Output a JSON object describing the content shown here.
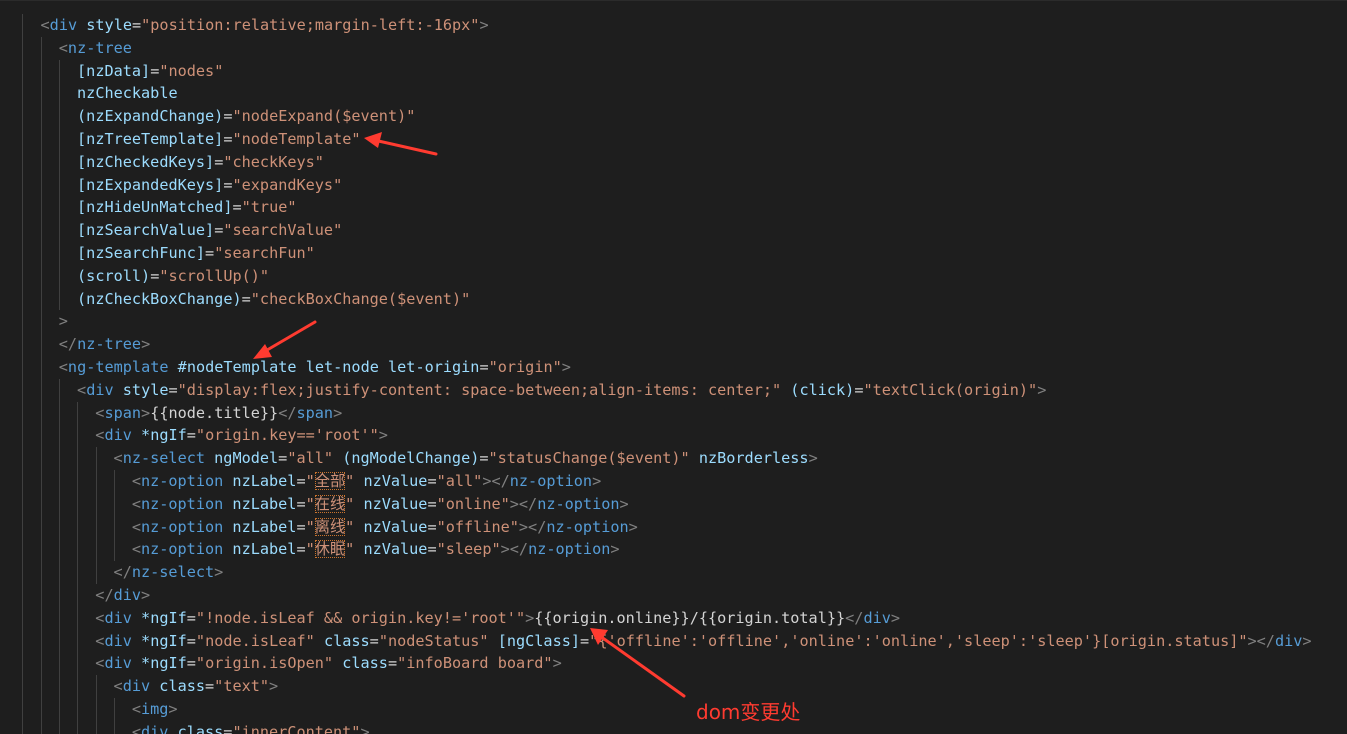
{
  "editor": {
    "theme_colors": {
      "background": "#1e1e1e",
      "tag": "#569cd6",
      "attribute": "#9cdcfe",
      "string": "#ce9178",
      "punctuation": "#808080",
      "text": "#d4d4d4",
      "annotation": "#ff3b30"
    },
    "lines": [
      {
        "indent": 2,
        "tokens": [
          [
            "p",
            "<"
          ],
          [
            "t",
            "div"
          ],
          [
            "x",
            " "
          ],
          [
            "a",
            "style"
          ],
          [
            "x",
            "="
          ],
          [
            "s",
            "\"position:relative;margin-left:-16px\""
          ],
          [
            "p",
            ">"
          ]
        ]
      },
      {
        "indent": 3,
        "tokens": [
          [
            "p",
            "<"
          ],
          [
            "t",
            "nz-tree"
          ]
        ]
      },
      {
        "indent": 4,
        "tokens": [
          [
            "a",
            "[nzData]"
          ],
          [
            "x",
            "="
          ],
          [
            "s",
            "\"nodes\""
          ]
        ]
      },
      {
        "indent": 4,
        "tokens": [
          [
            "a",
            "nzCheckable"
          ]
        ]
      },
      {
        "indent": 4,
        "tokens": [
          [
            "a",
            "(nzExpandChange)"
          ],
          [
            "x",
            "="
          ],
          [
            "s",
            "\"nodeExpand($event)\""
          ]
        ]
      },
      {
        "indent": 4,
        "tokens": [
          [
            "a",
            "[nzTreeTemplate]"
          ],
          [
            "x",
            "="
          ],
          [
            "s",
            "\"nodeTemplate\""
          ]
        ]
      },
      {
        "indent": 4,
        "tokens": [
          [
            "a",
            "[nzCheckedKeys]"
          ],
          [
            "x",
            "="
          ],
          [
            "s",
            "\"checkKeys\""
          ]
        ]
      },
      {
        "indent": 4,
        "tokens": [
          [
            "a",
            "[nzExpandedKeys]"
          ],
          [
            "x",
            "="
          ],
          [
            "s",
            "\"expandKeys\""
          ]
        ]
      },
      {
        "indent": 4,
        "tokens": [
          [
            "a",
            "[nzHideUnMatched]"
          ],
          [
            "x",
            "="
          ],
          [
            "s",
            "\"true\""
          ]
        ]
      },
      {
        "indent": 4,
        "tokens": [
          [
            "a",
            "[nzSearchValue]"
          ],
          [
            "x",
            "="
          ],
          [
            "s",
            "\"searchValue\""
          ]
        ]
      },
      {
        "indent": 4,
        "tokens": [
          [
            "a",
            "[nzSearchFunc]"
          ],
          [
            "x",
            "="
          ],
          [
            "s",
            "\"searchFun\""
          ]
        ]
      },
      {
        "indent": 4,
        "tokens": [
          [
            "a",
            "(scroll)"
          ],
          [
            "x",
            "="
          ],
          [
            "s",
            "\"scrollUp()\""
          ]
        ]
      },
      {
        "indent": 4,
        "tokens": [
          [
            "a",
            "(nzCheckBoxChange)"
          ],
          [
            "x",
            "="
          ],
          [
            "s",
            "\"checkBoxChange($event)\""
          ]
        ]
      },
      {
        "indent": 3,
        "tokens": [
          [
            "p",
            ">"
          ]
        ]
      },
      {
        "indent": 3,
        "tokens": [
          [
            "p",
            "</"
          ],
          [
            "t",
            "nz-tree"
          ],
          [
            "p",
            ">"
          ]
        ]
      },
      {
        "indent": 3,
        "tokens": [
          [
            "p",
            "<"
          ],
          [
            "t",
            "ng-template"
          ],
          [
            "x",
            " "
          ],
          [
            "a",
            "#nodeTemplate"
          ],
          [
            "x",
            " "
          ],
          [
            "a",
            "let-node"
          ],
          [
            "x",
            " "
          ],
          [
            "a",
            "let-origin"
          ],
          [
            "x",
            "="
          ],
          [
            "s",
            "\"origin\""
          ],
          [
            "p",
            ">"
          ]
        ]
      },
      {
        "indent": 4,
        "tokens": [
          [
            "p",
            "<"
          ],
          [
            "t",
            "div"
          ],
          [
            "x",
            " "
          ],
          [
            "a",
            "style"
          ],
          [
            "x",
            "="
          ],
          [
            "s",
            "\"display:flex;justify-content: space-between;align-items: center;\""
          ],
          [
            "x",
            " "
          ],
          [
            "a",
            "(click)"
          ],
          [
            "x",
            "="
          ],
          [
            "s",
            "\"textClick(origin)\""
          ],
          [
            "p",
            ">"
          ]
        ]
      },
      {
        "indent": 5,
        "tokens": [
          [
            "p",
            "<"
          ],
          [
            "t",
            "span"
          ],
          [
            "p",
            ">"
          ],
          [
            "x",
            "{{node.title}}"
          ],
          [
            "p",
            "</"
          ],
          [
            "t",
            "span"
          ],
          [
            "p",
            ">"
          ]
        ]
      },
      {
        "indent": 5,
        "tokens": [
          [
            "p",
            "<"
          ],
          [
            "t",
            "div"
          ],
          [
            "x",
            " "
          ],
          [
            "a",
            "*ngIf"
          ],
          [
            "x",
            "="
          ],
          [
            "s",
            "\"origin.key=='root'\""
          ],
          [
            "p",
            ">"
          ]
        ]
      },
      {
        "indent": 6,
        "tokens": [
          [
            "p",
            "<"
          ],
          [
            "t",
            "nz-select"
          ],
          [
            "x",
            " "
          ],
          [
            "a",
            "ngModel"
          ],
          [
            "x",
            "="
          ],
          [
            "s",
            "\"all\""
          ],
          [
            "x",
            " "
          ],
          [
            "a",
            "(ngModelChange)"
          ],
          [
            "x",
            "="
          ],
          [
            "s",
            "\"statusChange($event)\""
          ],
          [
            "x",
            " "
          ],
          [
            "a",
            "nzBorderless"
          ],
          [
            "p",
            ">"
          ]
        ]
      },
      {
        "indent": 7,
        "tokens": [
          [
            "p",
            "<"
          ],
          [
            "t",
            "nz-option"
          ],
          [
            "x",
            " "
          ],
          [
            "a",
            "nzLabel"
          ],
          [
            "x",
            "="
          ],
          [
            "s",
            "\""
          ],
          [
            "c",
            "全部"
          ],
          [
            "s",
            "\""
          ],
          [
            "x",
            " "
          ],
          [
            "a",
            "nzValue"
          ],
          [
            "x",
            "="
          ],
          [
            "s",
            "\"all\""
          ],
          [
            "p",
            "></"
          ],
          [
            "t",
            "nz-option"
          ],
          [
            "p",
            ">"
          ]
        ]
      },
      {
        "indent": 7,
        "tokens": [
          [
            "p",
            "<"
          ],
          [
            "t",
            "nz-option"
          ],
          [
            "x",
            " "
          ],
          [
            "a",
            "nzLabel"
          ],
          [
            "x",
            "="
          ],
          [
            "s",
            "\""
          ],
          [
            "c",
            "在线"
          ],
          [
            "s",
            "\""
          ],
          [
            "x",
            " "
          ],
          [
            "a",
            "nzValue"
          ],
          [
            "x",
            "="
          ],
          [
            "s",
            "\"online\""
          ],
          [
            "p",
            "></"
          ],
          [
            "t",
            "nz-option"
          ],
          [
            "p",
            ">"
          ]
        ]
      },
      {
        "indent": 7,
        "tokens": [
          [
            "p",
            "<"
          ],
          [
            "t",
            "nz-option"
          ],
          [
            "x",
            " "
          ],
          [
            "a",
            "nzLabel"
          ],
          [
            "x",
            "="
          ],
          [
            "s",
            "\""
          ],
          [
            "c",
            "离线"
          ],
          [
            "s",
            "\""
          ],
          [
            "x",
            " "
          ],
          [
            "a",
            "nzValue"
          ],
          [
            "x",
            "="
          ],
          [
            "s",
            "\"offline\""
          ],
          [
            "p",
            "></"
          ],
          [
            "t",
            "nz-option"
          ],
          [
            "p",
            ">"
          ]
        ]
      },
      {
        "indent": 7,
        "tokens": [
          [
            "p",
            "<"
          ],
          [
            "t",
            "nz-option"
          ],
          [
            "x",
            " "
          ],
          [
            "a",
            "nzLabel"
          ],
          [
            "x",
            "="
          ],
          [
            "s",
            "\""
          ],
          [
            "c",
            "休眠"
          ],
          [
            "s",
            "\""
          ],
          [
            "x",
            " "
          ],
          [
            "a",
            "nzValue"
          ],
          [
            "x",
            "="
          ],
          [
            "s",
            "\"sleep\""
          ],
          [
            "p",
            "></"
          ],
          [
            "t",
            "nz-option"
          ],
          [
            "p",
            ">"
          ]
        ]
      },
      {
        "indent": 6,
        "tokens": [
          [
            "p",
            "</"
          ],
          [
            "t",
            "nz-select"
          ],
          [
            "p",
            ">"
          ]
        ]
      },
      {
        "indent": 5,
        "tokens": [
          [
            "p",
            "</"
          ],
          [
            "t",
            "div"
          ],
          [
            "p",
            ">"
          ]
        ]
      },
      {
        "indent": 5,
        "tokens": [
          [
            "p",
            "<"
          ],
          [
            "t",
            "div"
          ],
          [
            "x",
            " "
          ],
          [
            "a",
            "*ngIf"
          ],
          [
            "x",
            "="
          ],
          [
            "s",
            "\"!node.isLeaf && origin.key!='root'\""
          ],
          [
            "p",
            ">"
          ],
          [
            "x",
            "{{origin.online}}/{{origin.total}}"
          ],
          [
            "p",
            "</"
          ],
          [
            "t",
            "div"
          ],
          [
            "p",
            ">"
          ]
        ]
      },
      {
        "indent": 5,
        "tokens": [
          [
            "p",
            "<"
          ],
          [
            "t",
            "div"
          ],
          [
            "x",
            " "
          ],
          [
            "a",
            "*ngIf"
          ],
          [
            "x",
            "="
          ],
          [
            "s",
            "\"node.isLeaf\""
          ],
          [
            "x",
            " "
          ],
          [
            "a",
            "class"
          ],
          [
            "x",
            "="
          ],
          [
            "s",
            "\"nodeStatus\""
          ],
          [
            "x",
            " "
          ],
          [
            "a",
            "[ngClass]"
          ],
          [
            "x",
            "="
          ],
          [
            "s",
            "\"{'offline':'offline','online':'online','sleep':'sleep'}[origin.status]\""
          ],
          [
            "p",
            "></"
          ],
          [
            "t",
            "div"
          ],
          [
            "p",
            ">"
          ]
        ]
      },
      {
        "indent": 5,
        "tokens": [
          [
            "p",
            "<"
          ],
          [
            "t",
            "div"
          ],
          [
            "x",
            " "
          ],
          [
            "a",
            "*ngIf"
          ],
          [
            "x",
            "="
          ],
          [
            "s",
            "\"origin.isOpen\""
          ],
          [
            "x",
            " "
          ],
          [
            "a",
            "class"
          ],
          [
            "x",
            "="
          ],
          [
            "s",
            "\"infoBoard board\""
          ],
          [
            "p",
            ">"
          ]
        ]
      },
      {
        "indent": 6,
        "tokens": [
          [
            "p",
            "<"
          ],
          [
            "t",
            "div"
          ],
          [
            "x",
            " "
          ],
          [
            "a",
            "class"
          ],
          [
            "x",
            "="
          ],
          [
            "s",
            "\"text\""
          ],
          [
            "p",
            ">"
          ]
        ]
      },
      {
        "indent": 7,
        "tokens": [
          [
            "p",
            "<"
          ],
          [
            "t",
            "img"
          ],
          [
            "p",
            ">"
          ]
        ]
      },
      {
        "indent": 7,
        "tokens": [
          [
            "p",
            "<"
          ],
          [
            "t",
            "div"
          ],
          [
            "x",
            " "
          ],
          [
            "a",
            "class"
          ],
          [
            "x",
            "="
          ],
          [
            "s",
            "\"innerContent\""
          ],
          [
            "p",
            ">"
          ]
        ]
      }
    ]
  },
  "annotation": {
    "label": "dom变更处",
    "arrow_count": 3
  }
}
